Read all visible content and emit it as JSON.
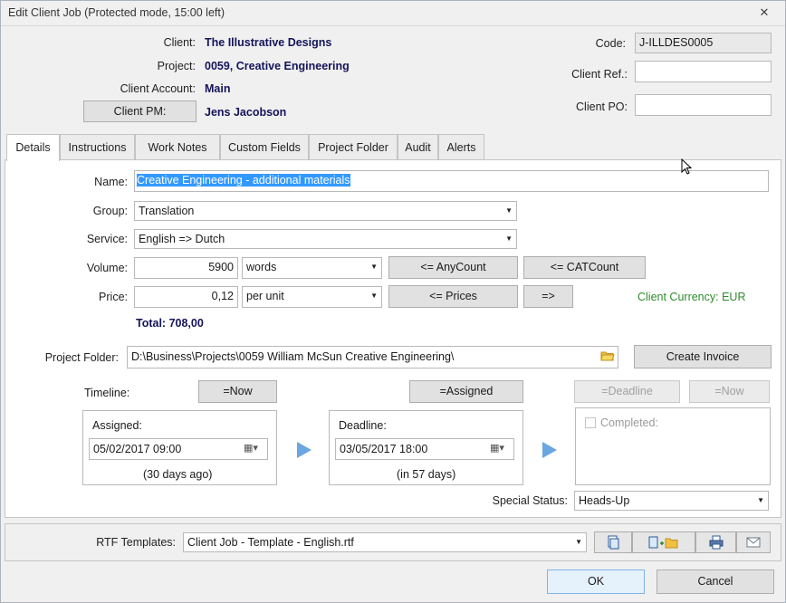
{
  "window": {
    "title": "Edit Client Job (Protected mode, 15:00 left)",
    "close_glyph": "✕"
  },
  "header": {
    "client_label": "Client:",
    "client_value": "The Illustrative Designs",
    "project_label": "Project:",
    "project_value": "0059, Creative Engineering",
    "account_label": "Client Account:",
    "account_value": "Main",
    "pm_button": "Client PM:",
    "pm_value": "Jens Jacobson",
    "code_label": "Code:",
    "code_value": "J-ILLDES0005",
    "ref_label": "Client Ref.:",
    "ref_value": "",
    "po_label": "Client PO:",
    "po_value": ""
  },
  "tabs": [
    {
      "label": "Details"
    },
    {
      "label": "Instructions"
    },
    {
      "label": "Work Notes"
    },
    {
      "label": "Custom Fields"
    },
    {
      "label": "Project Folder"
    },
    {
      "label": "Audit"
    },
    {
      "label": "Alerts"
    }
  ],
  "details": {
    "name_label": "Name:",
    "name_value": "Creative Engineering - additional materials",
    "group_label": "Group:",
    "group_value": "Translation",
    "service_label": "Service:",
    "service_value": "English => Dutch",
    "volume_label": "Volume:",
    "volume_value": "5900",
    "volume_unit": "words",
    "anycount_button": "<= AnyCount",
    "catcount_button": "<= CATCount",
    "price_label": "Price:",
    "price_value": "0,12",
    "price_unit": "per unit",
    "prices_button": "<= Prices",
    "arrow_button": "=>",
    "currency": "Client Currency: EUR",
    "total": "Total: 708,00",
    "folder_label": "Project Folder:",
    "folder_value": "D:\\Business\\Projects\\0059 William McSun Creative Engineering\\",
    "create_invoice": "Create Invoice"
  },
  "timeline": {
    "label": "Timeline:",
    "now_button": "=Now",
    "assigned_button": "=Assigned",
    "deadline_button": "=Deadline",
    "now_button_2": "=Now",
    "assigned_label": "Assigned:",
    "assigned_value": "05/02/2017 09:00",
    "assigned_note": "(30 days ago)",
    "deadline_label": "Deadline:",
    "deadline_value": "03/05/2017 18:00",
    "deadline_note": "(in 57 days)",
    "completed_label": "Completed:",
    "special_status_label": "Special Status:",
    "special_status_value": "Heads-Up"
  },
  "bottom": {
    "rtf_label": "RTF Templates:",
    "rtf_value": "Client Job - Template - English.rtf",
    "ok": "OK",
    "cancel": "Cancel"
  },
  "colors": {
    "accent_text": "#14145a",
    "currency_green": "#2e8b2e",
    "selection": "#3399ff"
  }
}
